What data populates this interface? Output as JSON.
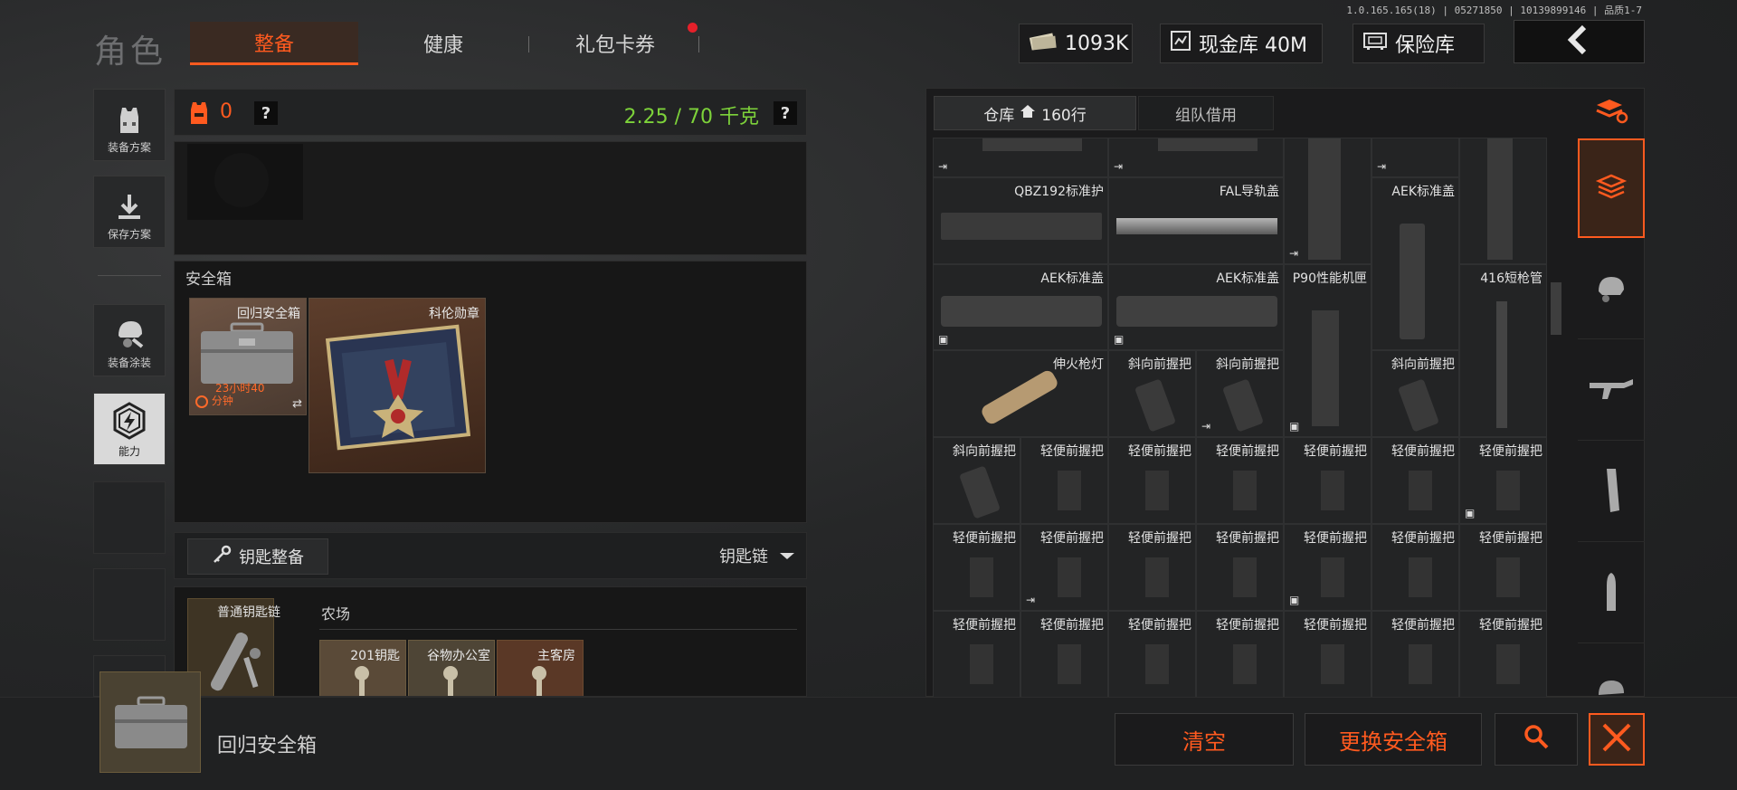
{
  "version": "1.0.165.165(18) | 05271850 | 10139899146 | 品质1-7",
  "page_title": "角色",
  "tabs": [
    {
      "label": "整备",
      "active": true
    },
    {
      "label": "健康",
      "active": false
    },
    {
      "label": "礼包卡券",
      "active": false,
      "notification": true
    }
  ],
  "currency": {
    "cash": "1093K",
    "vault_label": "现金库 40M",
    "insurance_label": "保险库"
  },
  "side_nav": [
    {
      "label": "装备方案",
      "icon": "vest-icon"
    },
    {
      "label": "保存方案",
      "icon": "download-icon"
    },
    {
      "label": "装备涂装",
      "icon": "helmet-paint-icon"
    },
    {
      "label": "能力",
      "icon": "ability-icon",
      "active": true
    }
  ],
  "loadout": {
    "armor_value": "0",
    "qmark": "?",
    "weight": "2.25 / 70 千克"
  },
  "safe_box": {
    "title": "安全箱",
    "items": [
      {
        "label": "回归安全箱",
        "timer_line1": "23小时40",
        "timer_line2": "分钟"
      },
      {
        "label": "科伦勋章"
      }
    ]
  },
  "keys": {
    "button_label": "钥匙整备",
    "dropdown_label": "钥匙链",
    "keychain_label": "普通钥匙链",
    "area_label": "农场",
    "key_items": [
      "201钥匙",
      "谷物办公室",
      "主客房"
    ]
  },
  "inventory": {
    "tabs": [
      {
        "label": "仓库",
        "rows": "160行",
        "active": true
      },
      {
        "label": "组队借用",
        "active": false
      }
    ],
    "row1": [
      "QBZ192标准护",
      "FAL导轨盖",
      "",
      "AEK标准盖",
      ""
    ],
    "row2": [
      "AEK标准盖",
      "AEK标准盖",
      "P90性能机匣",
      "416短枪管"
    ],
    "row3": [
      "伸火枪灯",
      "斜向前握把",
      "斜向前握把",
      "",
      "斜向前握把",
      ""
    ],
    "row4": [
      "斜向前握把",
      "轻便前握把",
      "轻便前握把",
      "轻便前握把",
      "轻便前握把",
      "轻便前握把",
      "轻便前握把"
    ],
    "row5": [
      "轻便前握把",
      "轻便前握把",
      "轻便前握把",
      "轻便前握把",
      "轻便前握把",
      "轻便前握把",
      "轻便前握把"
    ],
    "row6": [
      "轻便前握把",
      "轻便前握把",
      "轻便前握把",
      "轻便前握把",
      "轻便前握把",
      "轻便前握把",
      "轻便前握把"
    ]
  },
  "bottom": {
    "selected_item": "回归安全箱",
    "clear_label": "清空",
    "replace_label": "更换安全箱"
  },
  "colors": {
    "accent": "#ff5a1f",
    "weight_green": "#7dd23a",
    "notification_red": "#e5202a"
  }
}
